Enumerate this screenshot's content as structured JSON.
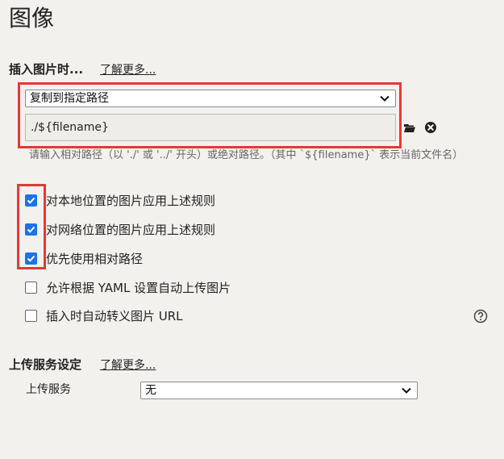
{
  "page": {
    "title": "图像"
  },
  "insert_section": {
    "heading": "插入图片时...",
    "learn_more": "了解更多...",
    "action_select": {
      "value": "复制到指定路径"
    },
    "path_input": {
      "value": "./${filename}"
    },
    "hint": "请输入相对路径（以 './' 或 '../' 开头）或绝对路径。（其中 `${filename}` 表示当前文件名）",
    "options": [
      {
        "label": "对本地位置的图片应用上述规则",
        "checked": true
      },
      {
        "label": "对网络位置的图片应用上述规则",
        "checked": true
      },
      {
        "label": "优先使用相对路径",
        "checked": true
      },
      {
        "label": "允许根据 YAML 设置自动上传图片",
        "checked": false
      },
      {
        "label": "插入时自动转义图片 URL",
        "checked": false
      }
    ]
  },
  "upload_section": {
    "heading": "上传服务设定",
    "learn_more": "了解更多...",
    "service_label": "上传服务",
    "service_select": {
      "value": "无"
    }
  },
  "colors": {
    "highlight": "#e53935",
    "checkbox_accent": "#1a73e8",
    "background": "#f3f1ee"
  },
  "icons": {
    "folder": "folder-icon",
    "clear": "close-circle-icon",
    "help": "help-circle-icon",
    "dropdown": "chevron-down-icon"
  }
}
